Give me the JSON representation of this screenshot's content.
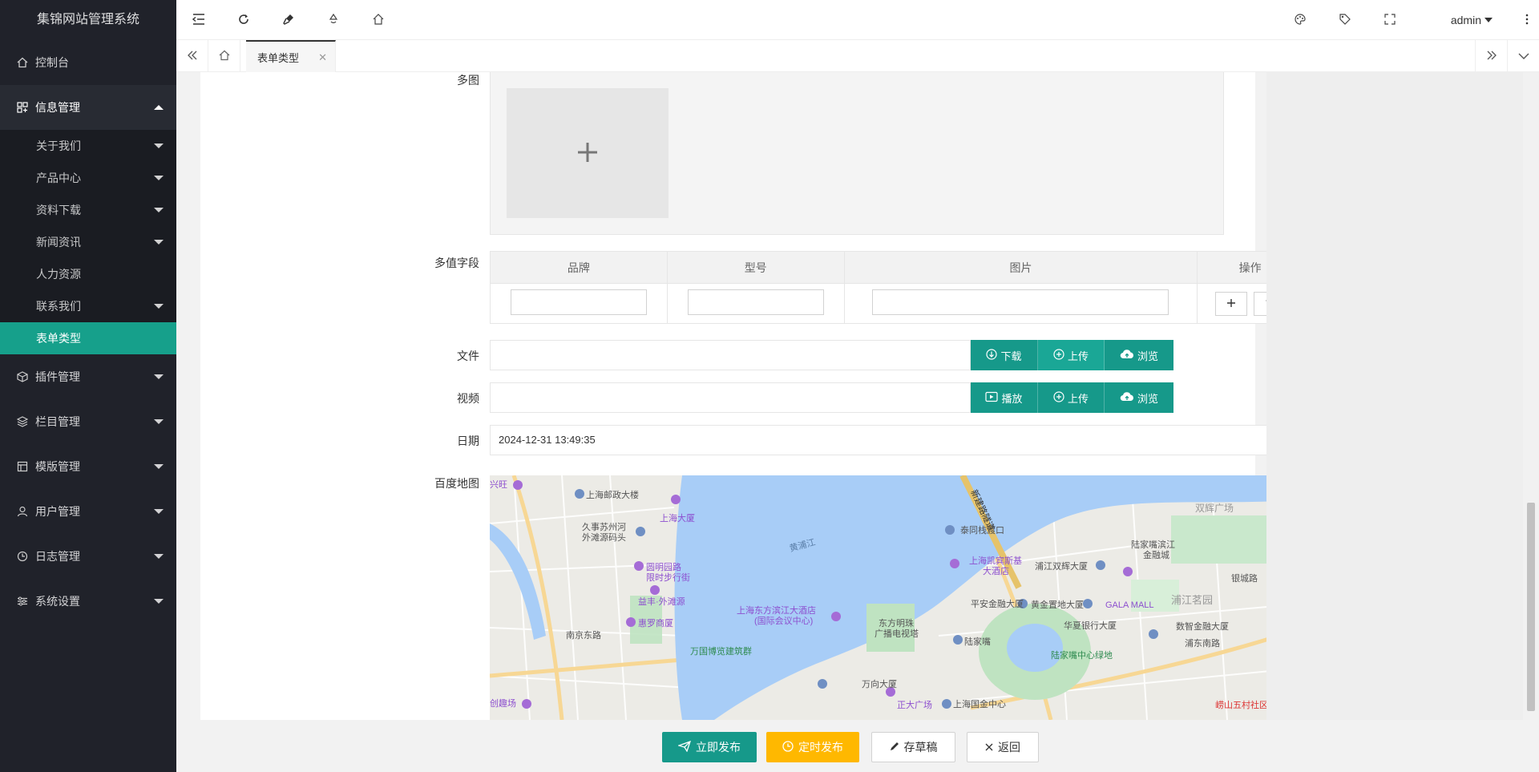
{
  "app": {
    "title": "集锦网站管理系统"
  },
  "sidebar": {
    "items": [
      {
        "label": "控制台",
        "icon": "home-icon"
      },
      {
        "label": "信息管理",
        "icon": "info-icon",
        "open": true,
        "children": [
          {
            "label": "关于我们"
          },
          {
            "label": "产品中心"
          },
          {
            "label": "资料下载"
          },
          {
            "label": "新闻资讯"
          },
          {
            "label": "人力资源"
          },
          {
            "label": "联系我们"
          },
          {
            "label": "表单类型",
            "active": true
          }
        ]
      },
      {
        "label": "插件管理",
        "icon": "plugin-icon"
      },
      {
        "label": "栏目管理",
        "icon": "layers-icon"
      },
      {
        "label": "模版管理",
        "icon": "template-icon"
      },
      {
        "label": "用户管理",
        "icon": "user-icon"
      },
      {
        "label": "日志管理",
        "icon": "clock-icon"
      },
      {
        "label": "系统设置",
        "icon": "settings-icon"
      }
    ]
  },
  "header": {
    "user": "admin"
  },
  "tabs": [
    {
      "label": "表单类型"
    }
  ],
  "form": {
    "multi_pic_label": "多图",
    "multi_field_label": "多值字段",
    "table_headers": [
      "品牌",
      "型号",
      "图片",
      "操作"
    ],
    "file_label": "文件",
    "video_label": "视频",
    "date_label": "日期",
    "date_value": "2024-12-31 13:49:35",
    "map_label": "百度地图",
    "file_buttons": [
      "下载",
      "上传",
      "浏览"
    ],
    "video_buttons": [
      "播放",
      "上传",
      "浏览"
    ]
  },
  "map_labels": {
    "l1": "上海邮政大楼",
    "l2": "上海大厦",
    "l3": "久事苏州河",
    "l4": "外滩源码头",
    "l5": "黄浦江",
    "l6": "圆明园路",
    "l7": "限时步行街",
    "l8": "益丰·外滩源",
    "l9": "惠罗商厦",
    "l10": "南京东路",
    "l11": "万国博览建筑群",
    "l12": "上海东方滨江大酒店",
    "l13": "(国际会议中心)",
    "l14": "东方明珠",
    "l15": "广播电视塔",
    "l16": "陆家嘴",
    "l17": "万向大厦",
    "l18": "正大广场",
    "l19": "上海国金中心",
    "l20": "泰同栈渡口",
    "l21": "上海凯宾斯基",
    "l22": "大酒店",
    "l23": "浦江双辉大厦",
    "l24": "陆家嘴滨江",
    "l25": "金融城",
    "l26": "黄金置地大厦",
    "l27": "GALA MALL",
    "l28": "浦江茗园",
    "l29": "平安金融大厦",
    "l30": "华夏银行大厦",
    "l31": "陆家嘴中心绿地",
    "l32": "浦东南路",
    "l33": "数智金融大厦",
    "l34": "崂山五村社区",
    "l35": "双辉广场",
    "l36": "银城路",
    "l37": "新建路隧道",
    "l38": "创趣场",
    "l39": "兴旺"
  },
  "footer": {
    "publish": "立即发布",
    "schedule": "定时发布",
    "draft": "存草稿",
    "back": "返回"
  },
  "colors": {
    "primary": "#16998a",
    "warning": "#ffb800",
    "sidebar": "#20222a"
  }
}
